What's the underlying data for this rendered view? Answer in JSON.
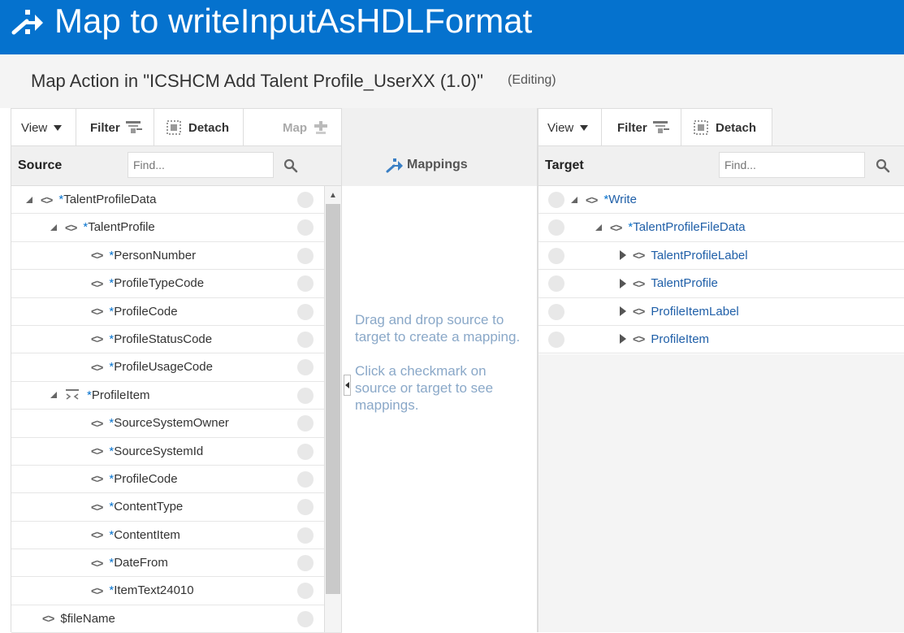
{
  "title": "Map to writeInputAsHDLFormat",
  "subtitle": "Map Action in \"ICSHCM Add Talent Profile_UserXX (1.0)\"",
  "status": "(Editing)",
  "source_toolbar": {
    "view": "View",
    "filter": "Filter",
    "detach": "Detach",
    "map": "Map"
  },
  "source_header": {
    "label": "Source",
    "find_placeholder": "Find..."
  },
  "source_tree": [
    {
      "req": "*",
      "name": "TalentProfileData"
    },
    {
      "req": "*",
      "name": "TalentProfile"
    },
    {
      "req": "*",
      "name": "PersonNumber"
    },
    {
      "req": "*",
      "name": "ProfileTypeCode"
    },
    {
      "req": "*",
      "name": "ProfileCode"
    },
    {
      "req": "*",
      "name": "ProfileStatusCode"
    },
    {
      "req": "*",
      "name": "ProfileUsageCode"
    },
    {
      "req": "*",
      "name": "ProfileItem"
    },
    {
      "req": "*",
      "name": "SourceSystemOwner"
    },
    {
      "req": "*",
      "name": "SourceSystemId"
    },
    {
      "req": "*",
      "name": "ProfileCode"
    },
    {
      "req": "*",
      "name": "ContentType"
    },
    {
      "req": "*",
      "name": "ContentItem"
    },
    {
      "req": "*",
      "name": "DateFrom"
    },
    {
      "req": "*",
      "name": "ItemText24010"
    },
    {
      "req": "",
      "name": "$fileName"
    }
  ],
  "mappings": {
    "label": "Mappings",
    "hint1": "Drag and drop source to target to create a mapping.",
    "hint2": "Click a checkmark on source or target to see mappings."
  },
  "target_toolbar": {
    "view": "View",
    "filter": "Filter",
    "detach": "Detach"
  },
  "target_header": {
    "label": "Target",
    "find_placeholder": "Find..."
  },
  "target_tree": [
    {
      "req": "*",
      "name": "Write"
    },
    {
      "req": "*",
      "name": "TalentProfileFileData"
    },
    {
      "req": "",
      "name": "TalentProfileLabel"
    },
    {
      "req": "",
      "name": "TalentProfile"
    },
    {
      "req": "",
      "name": "ProfileItemLabel"
    },
    {
      "req": "",
      "name": "ProfileItem"
    }
  ],
  "colors": {
    "brand": "#0572ce",
    "link": "#1f5fa8",
    "hint": "#8aa8c8"
  }
}
